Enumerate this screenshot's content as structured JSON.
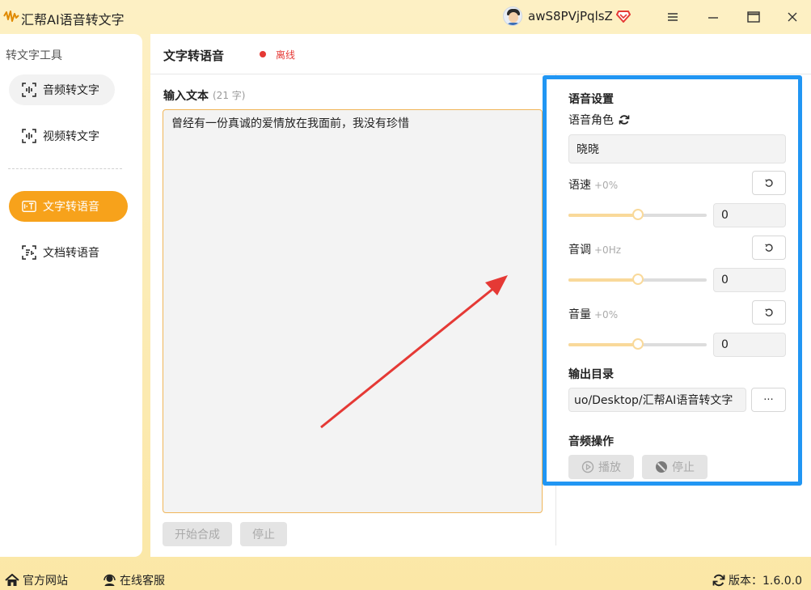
{
  "titlebar": {
    "app_title": "汇帮AI语音转文字",
    "username": "awS8PVjPqlsZ",
    "icons": [
      "app-logo-icon",
      "avatar",
      "vip-diamond-icon",
      "menu-icon",
      "minimize-icon",
      "maximize-icon",
      "close-icon"
    ]
  },
  "sidebar": {
    "title": "转文字工具",
    "items": [
      {
        "label": "音频转文字",
        "icon": "audio-wave-icon"
      },
      {
        "label": "视频转文字",
        "icon": "video-wave-icon"
      },
      {
        "label": "文字转语音",
        "icon": "text-to-speech-icon",
        "active": true
      },
      {
        "label": "文档转语音",
        "icon": "document-audio-icon"
      }
    ]
  },
  "main": {
    "page_title": "文字转语音",
    "status": "离线",
    "input_label": "输入文本",
    "char_count": "(21 字)",
    "input_text": "曾经有一份真诚的爱情放在我面前，我没有珍惜",
    "start_button": "开始合成",
    "stop_button": "停止"
  },
  "settings": {
    "title": "语音设置",
    "voice_role_label": "语音角色",
    "voice_value": "晓晓",
    "speed": {
      "label": "语速",
      "hint": "+0%",
      "value": "0",
      "level": 0.5
    },
    "pitch": {
      "label": "音调",
      "hint": "+0Hz",
      "value": "0",
      "level": 0.5
    },
    "volume": {
      "label": "音量",
      "hint": "+0%",
      "value": "0",
      "level": 0.5
    },
    "output_label": "输出目录",
    "output_path": "uo/Desktop/汇帮AI语音转文字",
    "browse_label": "···",
    "audio_ops_label": "音频操作",
    "play_button": "播放",
    "stop_button": "停止"
  },
  "footer": {
    "website": "官方网站",
    "support": "在线客服",
    "version": "版本：1.6.0.0"
  },
  "colors": {
    "accent": "#f7a21b",
    "highlight_border": "#2196f3",
    "annotation_arrow": "#e53935",
    "offline": "#e53935"
  }
}
